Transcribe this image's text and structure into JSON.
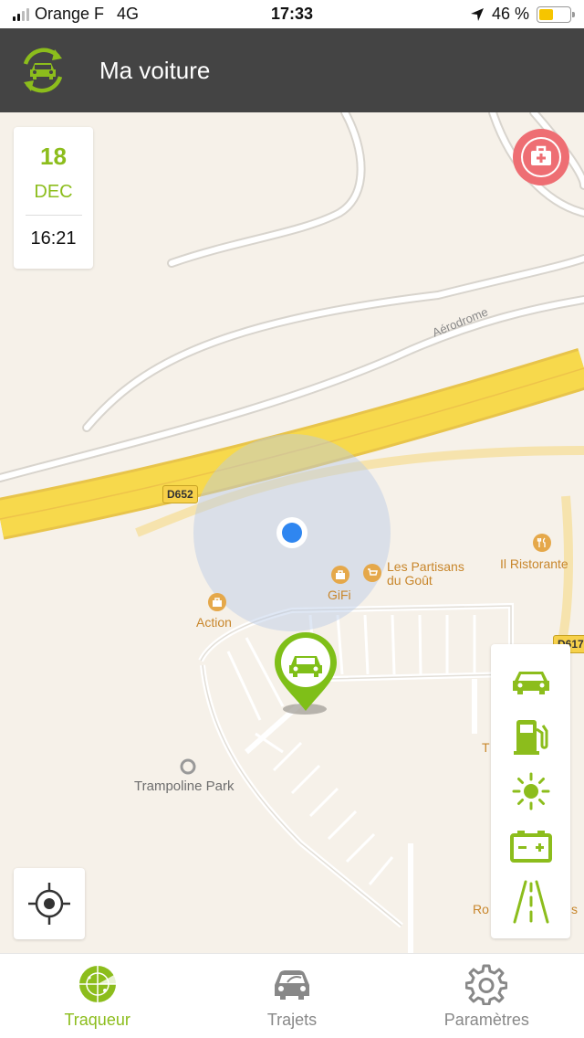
{
  "status": {
    "carrier": "Orange F",
    "network": "4G",
    "time": "17:33",
    "battery_text": "46 %",
    "battery_level": 0.46
  },
  "header": {
    "title": "Ma voiture",
    "logo_icon": "car-sync-icon"
  },
  "date_card": {
    "day": "18",
    "month": "DEC",
    "time": "16:21"
  },
  "map": {
    "road_shield_1": "D652",
    "road_shield_2": "D617",
    "road_name": "Aérodrome",
    "pois": {
      "partisans_line1": "Les Partisans",
      "partisans_line2": "du Goût",
      "ristorante": "Il Ristorante",
      "gifi": "GiFi",
      "action": "Action",
      "trampoline": "Trampoline Park",
      "partial_t": "T",
      "partial_ro": "Ro",
      "partial_s": "s"
    }
  },
  "side_tools": [
    {
      "icon": "car-icon"
    },
    {
      "icon": "fuel-pump-icon"
    },
    {
      "icon": "sun-icon"
    },
    {
      "icon": "battery-icon"
    },
    {
      "icon": "road-icon"
    }
  ],
  "tabs": [
    {
      "label": "Traqueur",
      "icon": "radar-icon",
      "active": true
    },
    {
      "label": "Trajets",
      "icon": "car-front-icon",
      "active": false
    },
    {
      "label": "Paramètres",
      "icon": "gear-icon",
      "active": false
    }
  ],
  "colors": {
    "accent": "#8cbd1c",
    "header_bg": "#444444",
    "firstaid": "#ee6e73",
    "map_bg": "#f6f1e9",
    "highway": "#f7d94c"
  }
}
